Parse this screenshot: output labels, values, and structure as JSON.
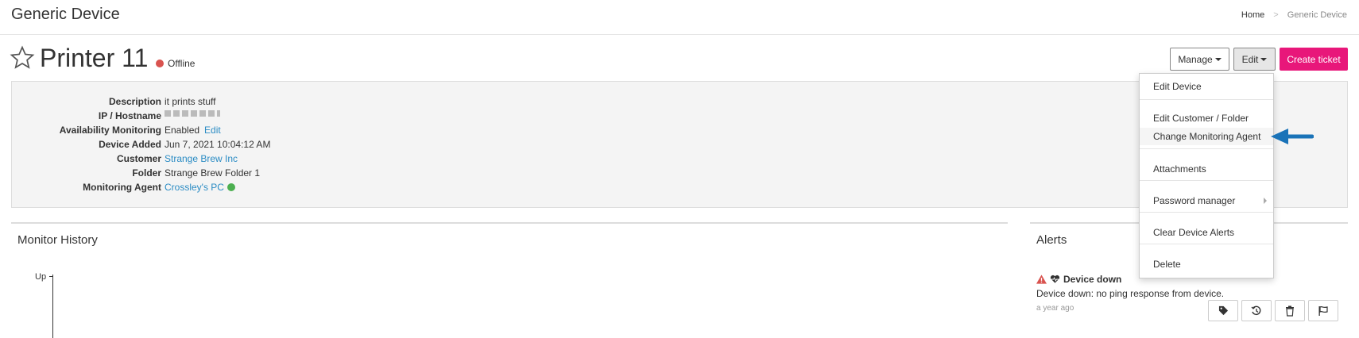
{
  "header": {
    "title": "Generic Device"
  },
  "breadcrumb": {
    "home": "Home",
    "separator": ">",
    "current": "Generic Device"
  },
  "device": {
    "name": "Printer 11",
    "status": "Offline"
  },
  "toolbar": {
    "manage_label": "Manage",
    "edit_label": "Edit",
    "create_ticket_label": "Create ticket"
  },
  "details": {
    "description": {
      "label": "Description",
      "value": "it prints stuff"
    },
    "ip_hostname": {
      "label": "IP / Hostname"
    },
    "availability": {
      "label": "Availability Monitoring",
      "value": "Enabled",
      "action": "Edit"
    },
    "device_added": {
      "label": "Device Added",
      "value": "Jun 7, 2021 10:04:12 AM"
    },
    "customer": {
      "label": "Customer",
      "value": "Strange Brew Inc"
    },
    "folder": {
      "label": "Folder",
      "value": "Strange Brew Folder 1"
    },
    "monitoring_agent": {
      "label": "Monitoring Agent",
      "value": "Crossley's PC"
    }
  },
  "monitor_history": {
    "title": "Monitor History",
    "y_label": "Up"
  },
  "alerts": {
    "title": "Alerts",
    "items": [
      {
        "title": "Device down",
        "description": "Device down: no ping response from device.",
        "time": "a year ago"
      }
    ]
  },
  "edit_menu": {
    "items": [
      {
        "label": "Edit Device"
      },
      {
        "label": "Edit Customer / Folder"
      },
      {
        "label": "Change Monitoring Agent"
      },
      {
        "label": "Attachments"
      },
      {
        "label": "Password manager"
      },
      {
        "label": "Clear Device Alerts"
      },
      {
        "label": "Delete"
      }
    ]
  },
  "colors": {
    "accent": "#e8177a",
    "link": "#2b8cc4",
    "offline": "#d9534f",
    "online": "#4caf50",
    "annotation_arrow": "#1a73b8"
  }
}
